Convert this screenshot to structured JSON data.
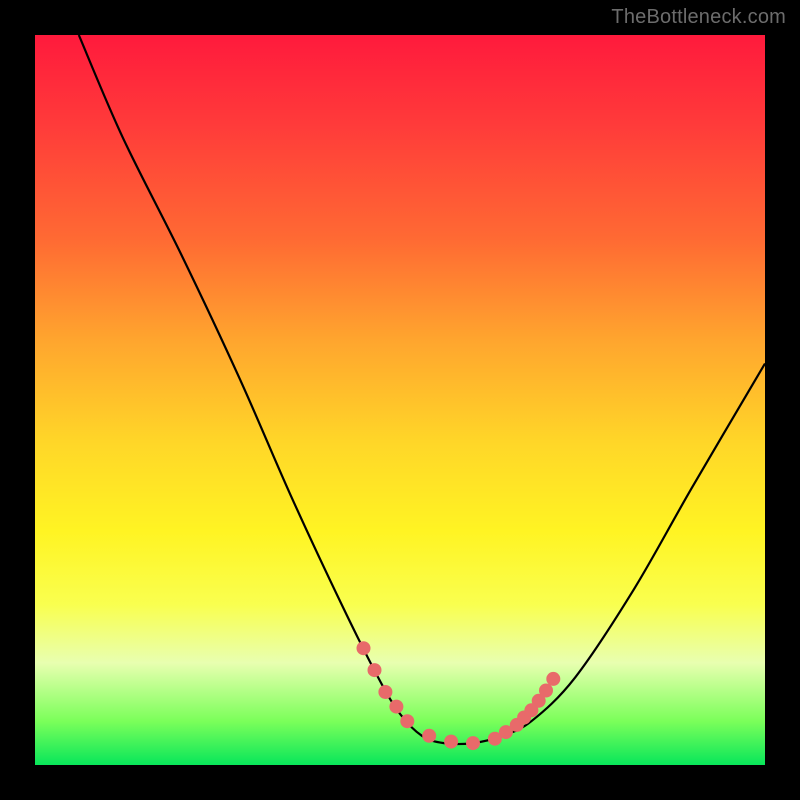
{
  "watermark": "TheBottleneck.com",
  "gradient": {
    "top": "#ff1a3c",
    "mid": "#fff423",
    "bottom": "#08e65a"
  },
  "chart_data": {
    "type": "line",
    "title": "",
    "xlabel": "",
    "ylabel": "",
    "xlim": [
      0,
      100
    ],
    "ylim": [
      0,
      100
    ],
    "notes": "V-shaped bottleneck curve over a vertical heat gradient. Lower is better (green). Dotted salmon markers highlight the trough.",
    "series": [
      {
        "name": "bottleneck-curve",
        "color": "#000000",
        "x": [
          6,
          12,
          20,
          28,
          35,
          42,
          47,
          50,
          53,
          56,
          60,
          64,
          68,
          74,
          82,
          90,
          100
        ],
        "y": [
          100,
          86,
          70,
          53,
          37,
          22,
          12,
          7,
          4,
          3,
          3,
          4,
          6,
          12,
          24,
          38,
          55
        ]
      }
    ],
    "markers": {
      "name": "trough-dots",
      "color": "#e86a6a",
      "radius_px": 7,
      "x": [
        45,
        46.5,
        48,
        49.5,
        51,
        54,
        57,
        60,
        63,
        64.5,
        66,
        67,
        68,
        69,
        70,
        71
      ],
      "y": [
        16,
        13,
        10,
        8,
        6,
        4,
        3.2,
        3,
        3.6,
        4.5,
        5.5,
        6.5,
        7.5,
        8.8,
        10.2,
        11.8
      ]
    }
  }
}
